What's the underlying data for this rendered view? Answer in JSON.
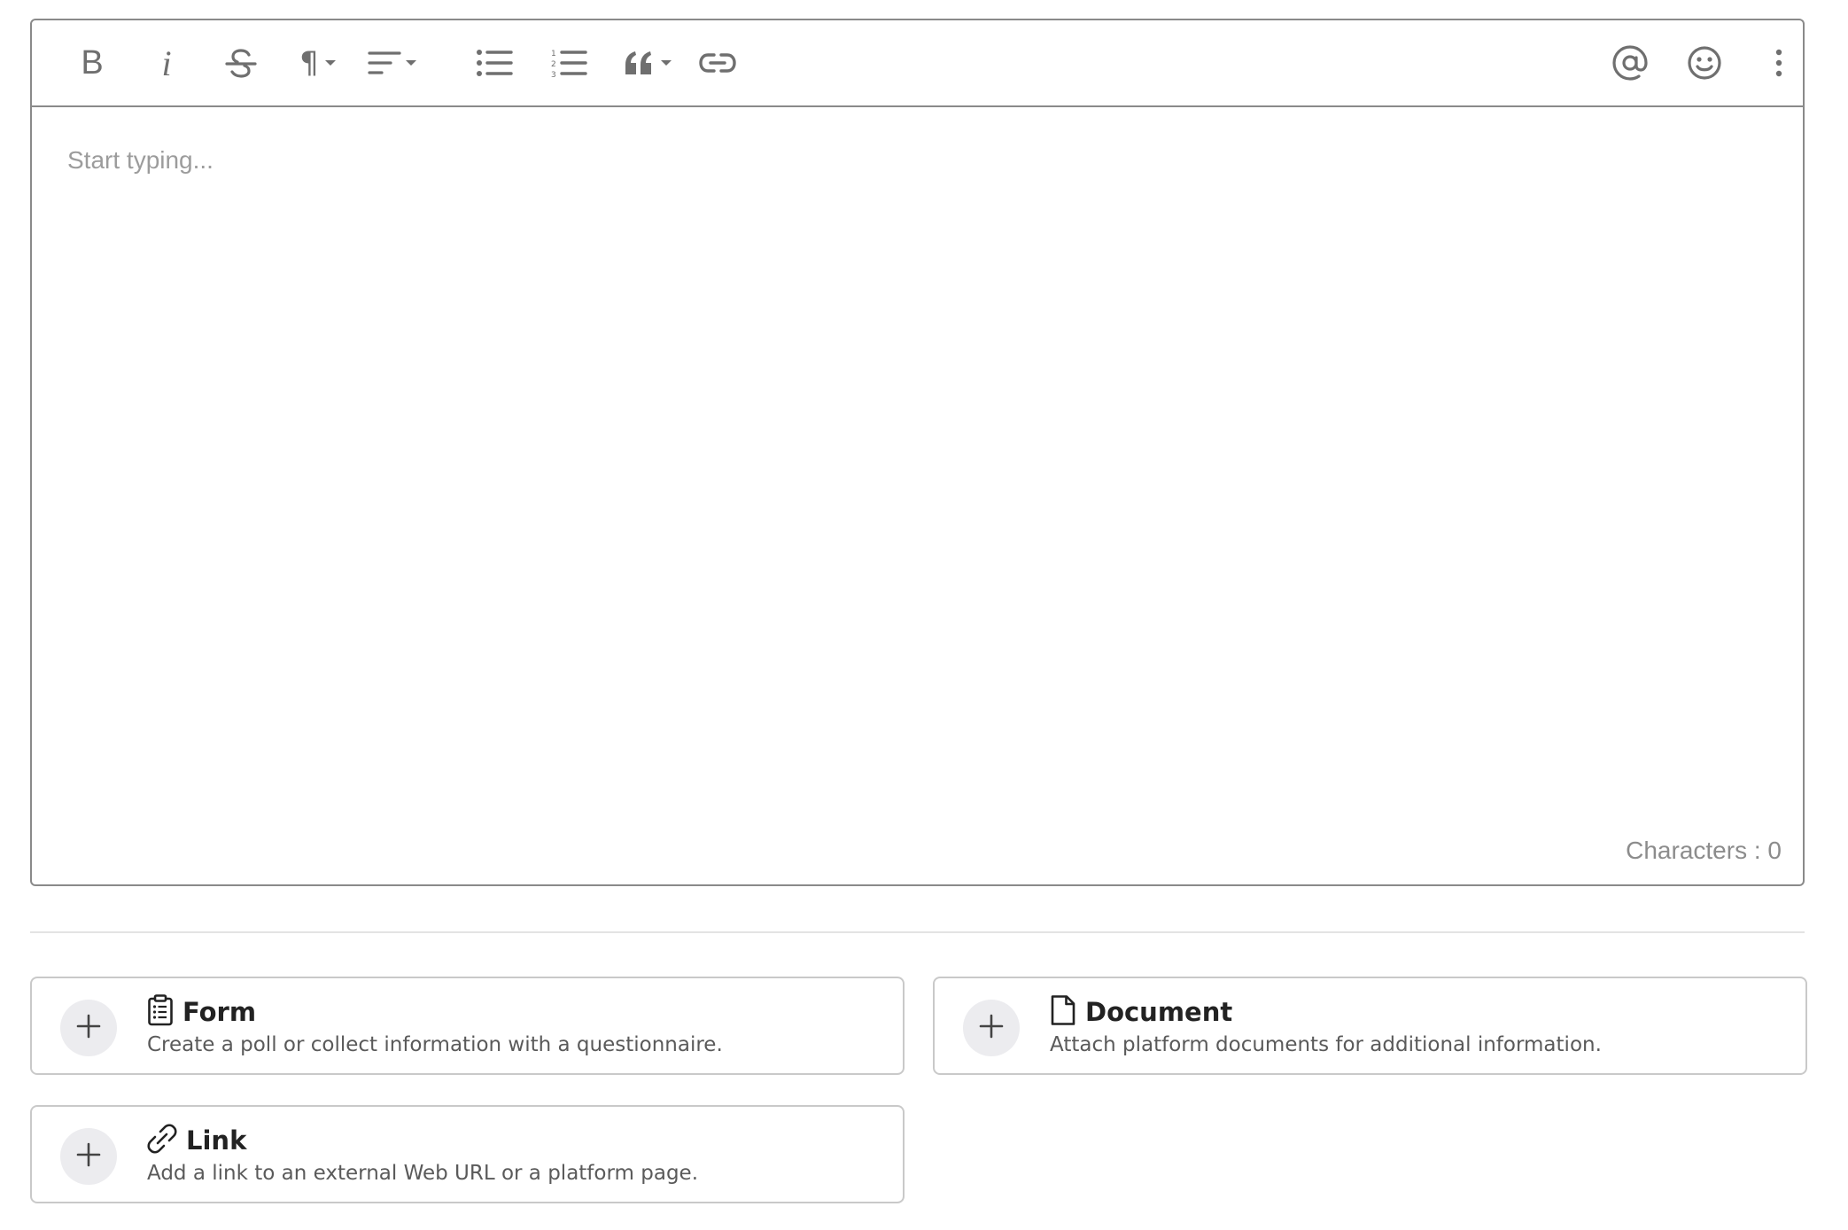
{
  "editor": {
    "placeholder": "Start typing...",
    "char_count_label": "Characters : 0",
    "toolbar": {
      "left_tools": [
        "bold-icon",
        "italic-icon",
        "strikethrough-icon",
        "paragraph-icon",
        "align-icon",
        "bullet-list-icon",
        "numbered-list-icon",
        "quote-icon",
        "link-icon"
      ],
      "right_tools": [
        "mention-icon",
        "emoji-icon",
        "more-vertical-icon"
      ],
      "bold_glyph": "B",
      "italic_glyph": "i",
      "paragraph_glyph": "¶"
    }
  },
  "attachments": [
    {
      "icon": "clipboard-icon",
      "title": "Form",
      "description": "Create a poll or collect information with a questionnaire."
    },
    {
      "icon": "document-icon",
      "title": "Document",
      "description": "Attach platform documents for additional information."
    },
    {
      "icon": "link-icon",
      "title": "Link",
      "description": "Add a link to an external Web URL or a platform page."
    }
  ],
  "colors": {
    "border": "#8a8a8a",
    "icon": "#6f6f6f",
    "placeholder": "#9c9c9c",
    "plus_bg": "#ececef"
  }
}
